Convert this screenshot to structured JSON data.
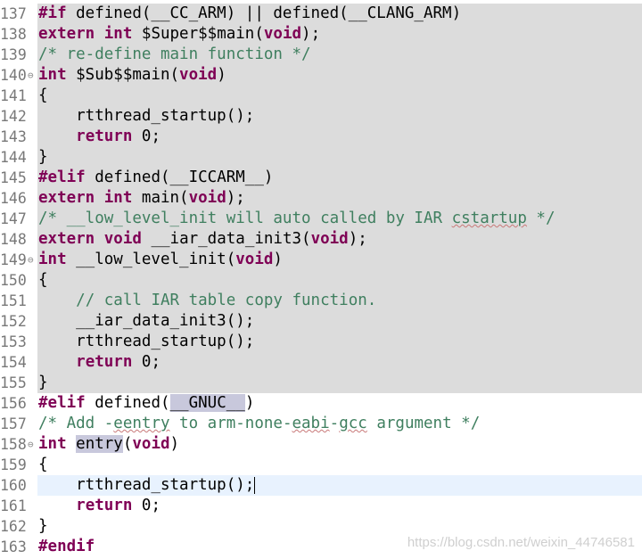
{
  "editor": {
    "lines": [
      {
        "num": "137",
        "active": false,
        "fold": false,
        "html": "<span class=\"kw\">#if</span> defined(__CC_ARM) || defined(__CLANG_ARM)"
      },
      {
        "num": "138",
        "active": false,
        "fold": false,
        "html": "<span class=\"kw\">extern</span> <span class=\"kw\">int</span> $Super$$main(<span class=\"kw\">void</span>);"
      },
      {
        "num": "139",
        "active": false,
        "fold": false,
        "html": "<span class=\"cm\">/* re-define main function */</span>"
      },
      {
        "num": "140",
        "active": false,
        "fold": true,
        "html": "<span class=\"kw\">int</span> $Sub$$main(<span class=\"kw\">void</span>)"
      },
      {
        "num": "141",
        "active": false,
        "fold": false,
        "html": "{"
      },
      {
        "num": "142",
        "active": false,
        "fold": false,
        "html": "    rtthread_startup();"
      },
      {
        "num": "143",
        "active": false,
        "fold": false,
        "html": "    <span class=\"kw\">return</span> 0;"
      },
      {
        "num": "144",
        "active": false,
        "fold": false,
        "html": "}"
      },
      {
        "num": "145",
        "active": false,
        "fold": false,
        "html": "<span class=\"kw\">#elif</span> defined(__ICCARM__)"
      },
      {
        "num": "146",
        "active": false,
        "fold": false,
        "html": "<span class=\"kw\">extern</span> <span class=\"kw\">int</span> main(<span class=\"kw\">void</span>);"
      },
      {
        "num": "147",
        "active": false,
        "fold": false,
        "html": "<span class=\"cm\">/* __low_level_init will auto called by IAR <span class=\"und\">cstartup</span> */</span>"
      },
      {
        "num": "148",
        "active": false,
        "fold": false,
        "html": "<span class=\"kw\">extern</span> <span class=\"kw\">void</span> __iar_data_init3(<span class=\"kw\">void</span>);"
      },
      {
        "num": "149",
        "active": false,
        "fold": true,
        "html": "<span class=\"kw\">int</span> __low_level_init(<span class=\"kw\">void</span>)"
      },
      {
        "num": "150",
        "active": false,
        "fold": false,
        "html": "{"
      },
      {
        "num": "151",
        "active": false,
        "fold": false,
        "html": "    <span class=\"cm\">// call IAR table copy function.</span>"
      },
      {
        "num": "152",
        "active": false,
        "fold": false,
        "html": "    __iar_data_init3();"
      },
      {
        "num": "153",
        "active": false,
        "fold": false,
        "html": "    rtthread_startup();"
      },
      {
        "num": "154",
        "active": false,
        "fold": false,
        "html": "    <span class=\"kw\">return</span> 0;"
      },
      {
        "num": "155",
        "active": false,
        "fold": false,
        "html": "}"
      },
      {
        "num": "156",
        "active": true,
        "fold": false,
        "html": "<span class=\"kw\">#elif</span> defined(<span class=\"sel\">__GNUC__</span>)"
      },
      {
        "num": "157",
        "active": true,
        "fold": false,
        "html": "<span class=\"cm\">/* Add -<span class=\"und\">eentry</span> to arm-none-<span class=\"und\">eabi</span>-<span class=\"und\">gcc</span> argument */</span>"
      },
      {
        "num": "158",
        "active": true,
        "fold": true,
        "html": "<span class=\"kw\">int</span> <span class=\"sel\">entry</span>(<span class=\"kw\">void</span>)"
      },
      {
        "num": "159",
        "active": true,
        "fold": false,
        "html": "{"
      },
      {
        "num": "160",
        "active": true,
        "fold": false,
        "current": true,
        "html": "    rtthread_startup();<span class=\"caret\"></span>"
      },
      {
        "num": "161",
        "active": true,
        "fold": false,
        "html": "    <span class=\"kw\">return</span> 0;"
      },
      {
        "num": "162",
        "active": true,
        "fold": false,
        "html": "}"
      },
      {
        "num": "163",
        "active": true,
        "fold": false,
        "html": "<span class=\"kw\">#endif</span>"
      }
    ]
  },
  "watermark": "https://blog.csdn.net/weixin_44746581",
  "colors": {
    "keyword": "#7f0055",
    "comment": "#3f7f5f",
    "inactive_bg": "#dcdcdc",
    "current_line_bg": "#e8f2fe",
    "occurrence_bg": "#c8c8dc"
  }
}
